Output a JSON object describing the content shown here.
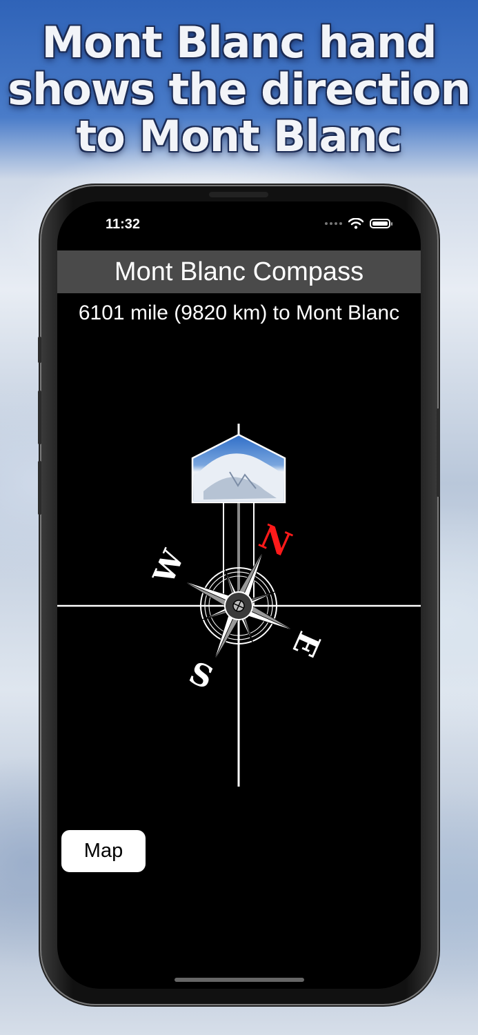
{
  "promo": {
    "headline_line1": "Mont Blanc hand",
    "headline_line2": "shows the direction",
    "headline_line3": "to Mont Blanc"
  },
  "status_bar": {
    "time": "11:32",
    "icons": [
      "signal-dots-icon",
      "wifi-icon",
      "battery-icon"
    ]
  },
  "app": {
    "title": "Mont Blanc Compass",
    "distance_text": "6101 mile (9820 km) to Mont Blanc",
    "map_button_label": "Map"
  },
  "compass": {
    "labels": {
      "north": "N",
      "east": "E",
      "south": "S",
      "west": "W"
    },
    "colors": {
      "north": "#ff1a1a",
      "other": "#ffffff",
      "background": "#000000"
    },
    "mountain_icon": "mont-blanc-photo-icon"
  }
}
